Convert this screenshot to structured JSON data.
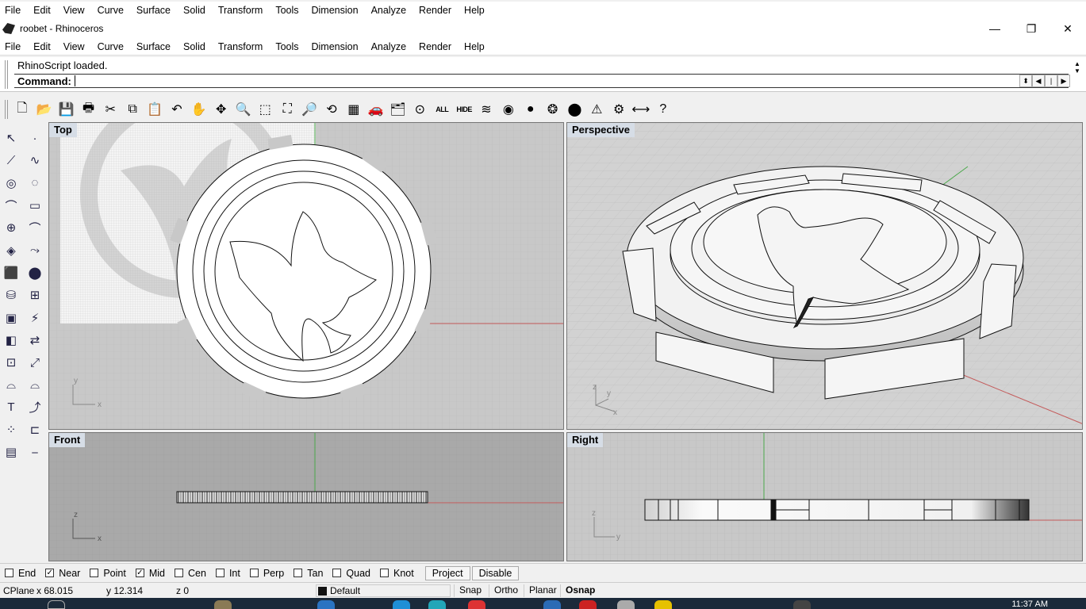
{
  "top_menu": [
    "File",
    "Edit",
    "View",
    "Curve",
    "Surface",
    "Solid",
    "Transform",
    "Tools",
    "Dimension",
    "Analyze",
    "Render",
    "Help"
  ],
  "window": {
    "title": "roobet - Rhinoceros",
    "minimize_icon": "minimize-icon",
    "restore_icon": "restore-icon",
    "close_icon": "close-icon"
  },
  "menu": [
    "File",
    "Edit",
    "View",
    "Curve",
    "Surface",
    "Solid",
    "Transform",
    "Tools",
    "Dimension",
    "Analyze",
    "Render",
    "Help"
  ],
  "command": {
    "history": "RhinoScript loaded.",
    "label": "Command:",
    "value": ""
  },
  "toolbar": {
    "items": [
      {
        "name": "new-icon",
        "glyph": "🗋"
      },
      {
        "name": "open-icon",
        "glyph": "📂"
      },
      {
        "name": "save-icon",
        "glyph": "💾"
      },
      {
        "name": "print-icon",
        "glyph": "🖶"
      },
      {
        "name": "cut-icon",
        "glyph": "✂"
      },
      {
        "name": "copy-icon",
        "glyph": "⧉"
      },
      {
        "name": "paste-icon",
        "glyph": "📋"
      },
      {
        "name": "undo-icon",
        "glyph": "↶"
      },
      {
        "name": "pan-icon",
        "glyph": "✋"
      },
      {
        "name": "rotate-view-icon",
        "glyph": "✥"
      },
      {
        "name": "zoom-dynamic-icon",
        "glyph": "🔍"
      },
      {
        "name": "zoom-window-icon",
        "glyph": "⬚"
      },
      {
        "name": "zoom-extents-icon",
        "glyph": "⛶"
      },
      {
        "name": "zoom-selected-icon",
        "glyph": "🔎"
      },
      {
        "name": "undo-view-icon",
        "glyph": "⟲"
      },
      {
        "name": "four-viewports-icon",
        "glyph": "▦"
      },
      {
        "name": "car-icon",
        "glyph": "🚗"
      },
      {
        "name": "layer-icon",
        "glyph": "🗂"
      },
      {
        "name": "point-object-icon",
        "glyph": "⊙"
      },
      {
        "name": "show-all-icon",
        "glyph": "ALL"
      },
      {
        "name": "hide-icon",
        "glyph": "HIDE"
      },
      {
        "name": "layers-icon",
        "glyph": "≋"
      },
      {
        "name": "color-wheel-icon",
        "glyph": "◉"
      },
      {
        "name": "render-sphere-icon",
        "glyph": "●"
      },
      {
        "name": "render-preview-icon",
        "glyph": "❂"
      },
      {
        "name": "environment-sphere-icon",
        "glyph": "⬤"
      },
      {
        "name": "light-icon",
        "glyph": "⚠"
      },
      {
        "name": "settings-gear-icon",
        "glyph": "⚙"
      },
      {
        "name": "dimension-icon",
        "glyph": "⟷"
      },
      {
        "name": "help-icon",
        "glyph": "?"
      }
    ]
  },
  "left_tools": {
    "col1": [
      {
        "name": "select-arrow-icon",
        "glyph": "↖"
      },
      {
        "name": "polyline-icon",
        "glyph": "⟋"
      },
      {
        "name": "circle-icon",
        "glyph": "◎"
      },
      {
        "name": "curve-icon",
        "glyph": "⌒"
      },
      {
        "name": "ellipse-icon",
        "glyph": "⊕"
      },
      {
        "name": "surface-corner-icon",
        "glyph": "◈"
      },
      {
        "name": "box-icon",
        "glyph": "⬛"
      },
      {
        "name": "cylinder-icon",
        "glyph": "⛁"
      },
      {
        "name": "mesh-icon",
        "glyph": "▣"
      },
      {
        "name": "boolean-icon",
        "glyph": "◧"
      },
      {
        "name": "transform-box-icon",
        "glyph": "⊡"
      },
      {
        "name": "arc-icon",
        "glyph": "⌓"
      },
      {
        "name": "text-icon",
        "glyph": "T"
      },
      {
        "name": "array-icon",
        "glyph": "⁘"
      },
      {
        "name": "grid-block-icon",
        "glyph": "▤"
      }
    ],
    "col2": [
      {
        "name": "point-icon",
        "glyph": "·"
      },
      {
        "name": "freeform-curve-icon",
        "glyph": "∿"
      },
      {
        "name": "arc-center-icon",
        "glyph": "◌"
      },
      {
        "name": "rectangle-icon",
        "glyph": "▭"
      },
      {
        "name": "curve-fillet-icon",
        "glyph": "⌒"
      },
      {
        "name": "sweep-icon",
        "glyph": "⤳"
      },
      {
        "name": "sphere-icon",
        "glyph": "⬤"
      },
      {
        "name": "extrude-icon",
        "glyph": "⊞"
      },
      {
        "name": "paint-icon",
        "glyph": "⚡"
      },
      {
        "name": "move-icon",
        "glyph": "⇄"
      },
      {
        "name": "scale-icon",
        "glyph": "⤢"
      },
      {
        "name": "split-icon",
        "glyph": "⌓"
      },
      {
        "name": "rotate-icon",
        "glyph": "⤴"
      },
      {
        "name": "mirror-icon",
        "glyph": "⊏"
      },
      {
        "name": "dimension-line-icon",
        "glyph": "⎯"
      }
    ]
  },
  "viewports": {
    "top": {
      "label": "Top",
      "axis_x": "x",
      "axis_y": "y"
    },
    "perspective": {
      "label": "Perspective",
      "axis_x": "x",
      "axis_y": "y",
      "axis_z": "z"
    },
    "front": {
      "label": "Front",
      "axis_x": "x",
      "axis_z": "z"
    },
    "right": {
      "label": "Right",
      "axis_y": "y",
      "axis_z": "z"
    }
  },
  "osnap": {
    "items": [
      {
        "label": "End",
        "checked": false
      },
      {
        "label": "Near",
        "checked": true
      },
      {
        "label": "Point",
        "checked": false
      },
      {
        "label": "Mid",
        "checked": true
      },
      {
        "label": "Cen",
        "checked": false
      },
      {
        "label": "Int",
        "checked": false
      },
      {
        "label": "Perp",
        "checked": false
      },
      {
        "label": "Tan",
        "checked": false
      },
      {
        "label": "Quad",
        "checked": false
      },
      {
        "label": "Knot",
        "checked": false
      }
    ],
    "project_label": "Project",
    "disable_label": "Disable"
  },
  "status": {
    "cplane": "CPlane",
    "x": "x 68.015",
    "y": "y 12.314",
    "z": "z 0",
    "layer": "Default",
    "snap": "Snap",
    "ortho": "Ortho",
    "planar": "Planar",
    "osnap": "Osnap"
  },
  "taskbar": {
    "clock": "11:37 AM"
  },
  "colors": {
    "viewport_bg": "#c8c8c8",
    "grid_line": "#b8b8b8",
    "x_axis": "#c45a5a",
    "y_axis": "#4aa84a",
    "label_bg": "#d6dde6"
  }
}
